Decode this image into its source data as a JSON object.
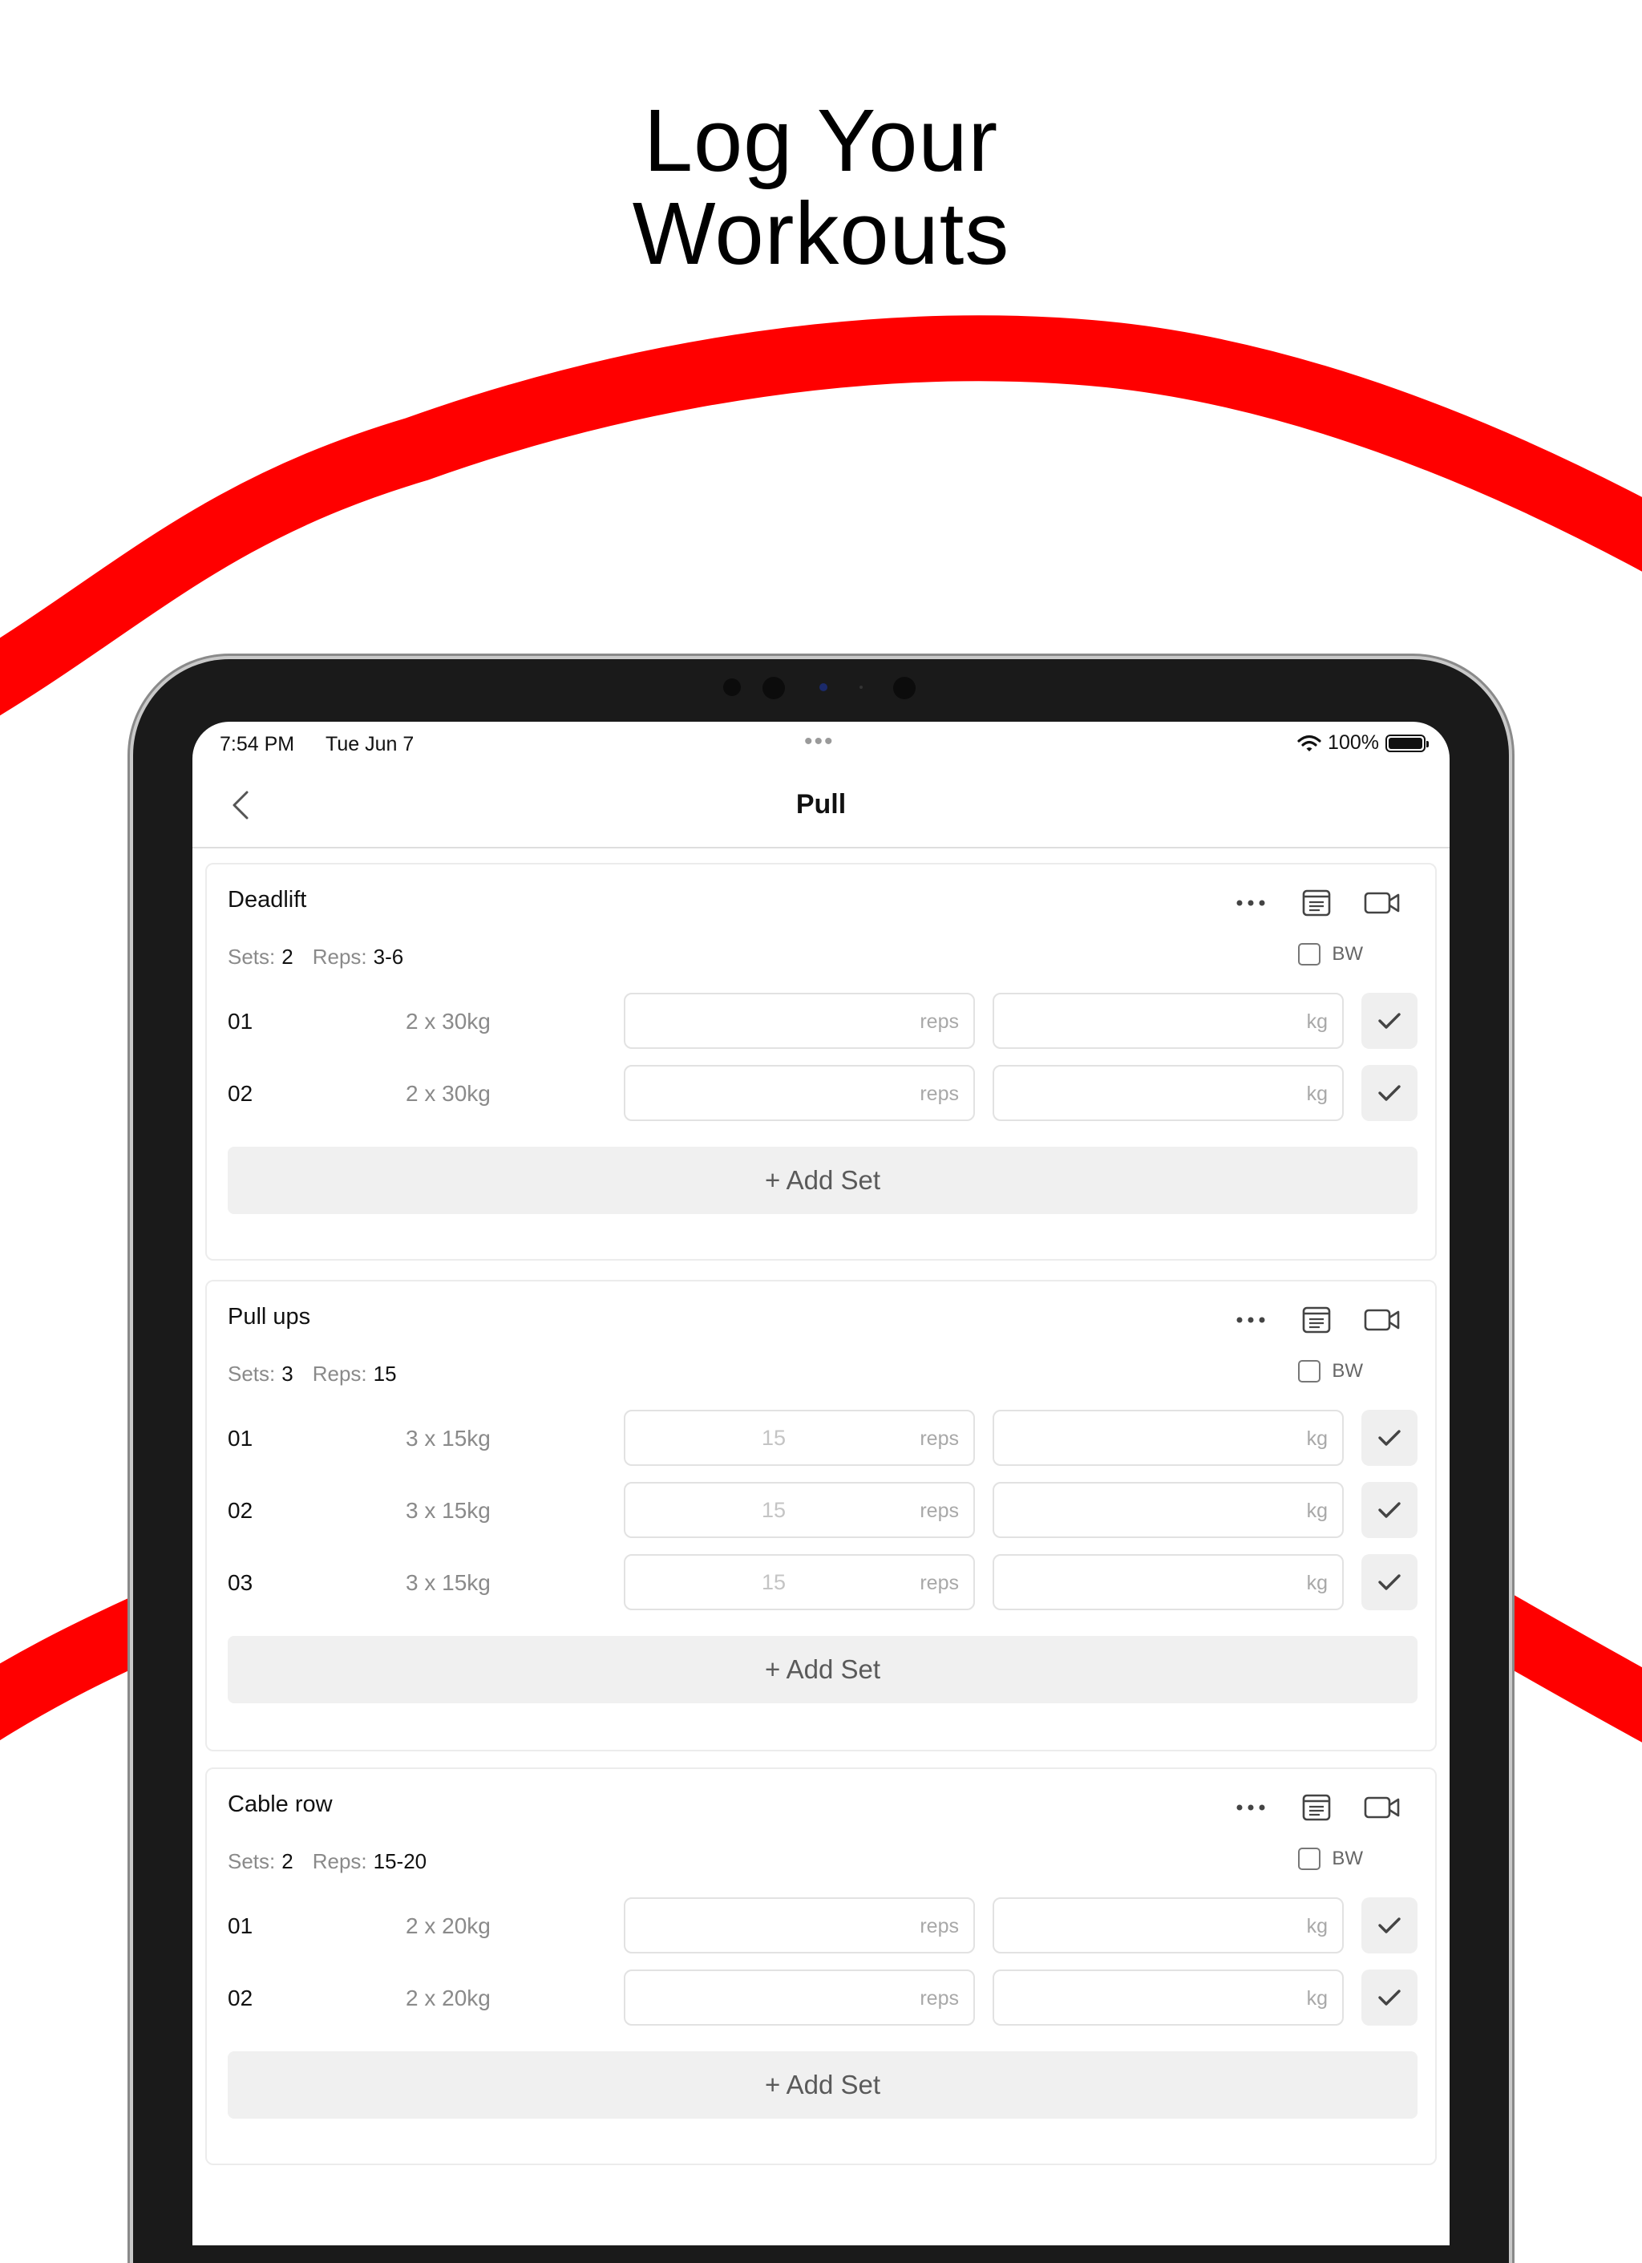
{
  "headline": {
    "line1": "Log Your",
    "line2": "Workouts"
  },
  "colors": {
    "accent": "#ff0000",
    "frame": "#1a1a1a"
  },
  "status_bar": {
    "time": "7:54 PM",
    "date": "Tue Jun 7",
    "battery": "100%"
  },
  "nav": {
    "title": "Pull",
    "back_icon": "chevron-left-icon"
  },
  "exercises": [
    {
      "name": "Deadlift",
      "sets_label": "Sets:",
      "sets": "2",
      "reps_label": "Reps:",
      "reps": "3-6",
      "bw_label": "BW",
      "rows": [
        {
          "num": "01",
          "target": "2 x 30kg",
          "reps_value": "",
          "reps_placeholder": "reps",
          "kg_placeholder": "kg"
        },
        {
          "num": "02",
          "target": "2 x 30kg",
          "reps_value": "",
          "reps_placeholder": "reps",
          "kg_placeholder": "kg"
        }
      ],
      "add_label": "+ Add Set"
    },
    {
      "name": "Pull ups",
      "sets_label": "Sets:",
      "sets": "3",
      "reps_label": "Reps:",
      "reps": "15",
      "bw_label": "BW",
      "rows": [
        {
          "num": "01",
          "target": "3 x 15kg",
          "reps_value": "15",
          "reps_placeholder": "reps",
          "kg_placeholder": "kg"
        },
        {
          "num": "02",
          "target": "3 x 15kg",
          "reps_value": "15",
          "reps_placeholder": "reps",
          "kg_placeholder": "kg"
        },
        {
          "num": "03",
          "target": "3 x 15kg",
          "reps_value": "15",
          "reps_placeholder": "reps",
          "kg_placeholder": "kg"
        }
      ],
      "add_label": "+ Add Set"
    },
    {
      "name": "Cable row",
      "sets_label": "Sets:",
      "sets": "2",
      "reps_label": "Reps:",
      "reps": "15-20",
      "bw_label": "BW",
      "rows": [
        {
          "num": "01",
          "target": "2 x 20kg",
          "reps_value": "",
          "reps_placeholder": "reps",
          "kg_placeholder": "kg"
        },
        {
          "num": "02",
          "target": "2 x 20kg",
          "reps_value": "",
          "reps_placeholder": "reps",
          "kg_placeholder": "kg"
        }
      ],
      "add_label": "+ Add Set"
    }
  ]
}
